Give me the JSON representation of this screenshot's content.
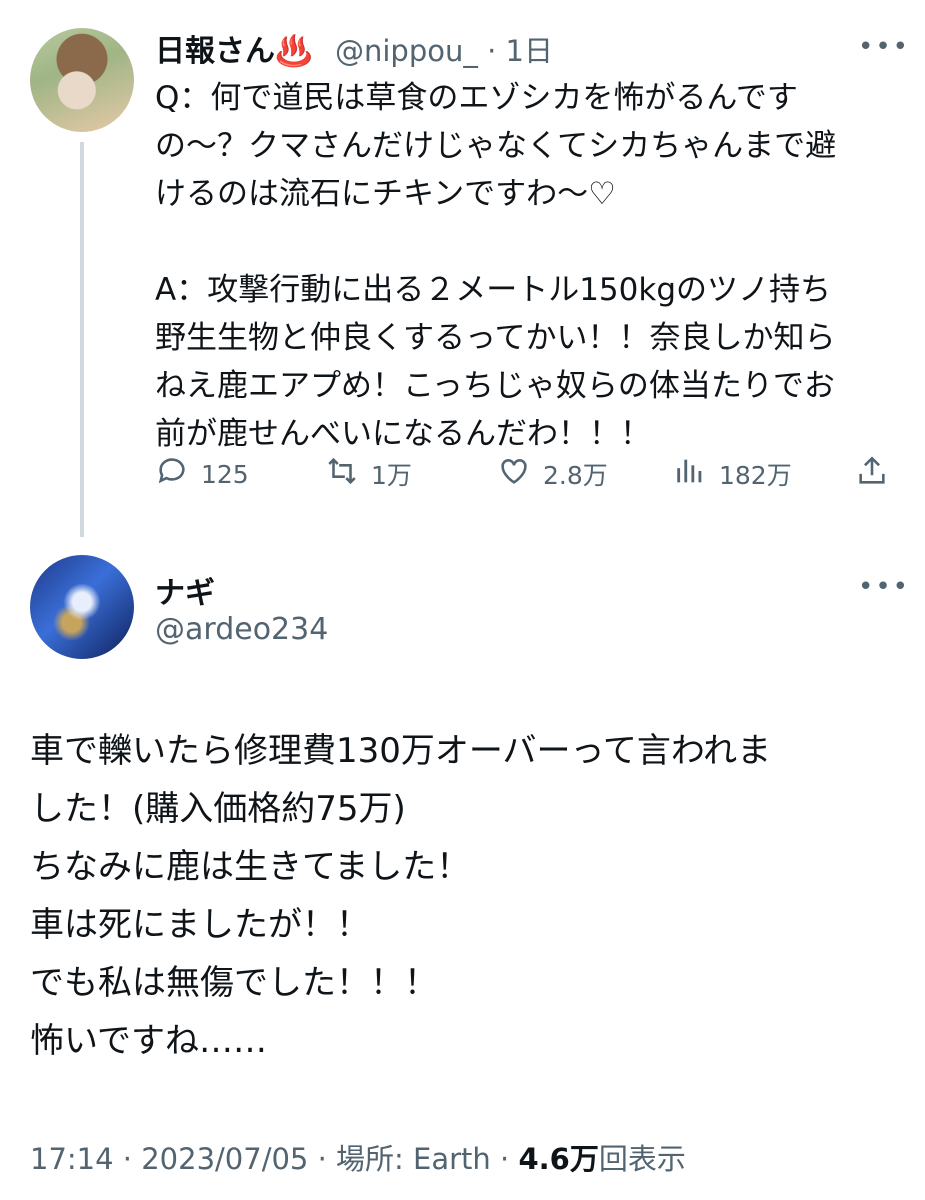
{
  "parent_tweet": {
    "display_name": "日報さん♨️",
    "handle": "@nippou_",
    "time": "· 1日",
    "more": "•••",
    "body": "Q：何で道民は草食のエゾシカを怖がるんです\nの〜？クマさんだけじゃなくてシカちゃんまで避\nけるのは流石にチキンですわ〜♡\n\nA：攻撃行動に出る２メートル150kgのツノ持ち\n野生生物と仲良くするってかい！！奈良しか知ら\nねえ鹿エアプめ！こっちじゃ奴らの体当たりでお\n前が鹿せんべいになるんだわ！！！",
    "stats": {
      "replies": "125",
      "retweets": "1万",
      "likes": "2.8万",
      "views": "182万"
    }
  },
  "reply_tweet": {
    "display_name": "ナギ",
    "handle": "@ardeo234",
    "more": "•••",
    "body": "車で轢いたら修理費130万オーバーって言われま\nした！(購入価格約75万)\nちなみに鹿は生きてました！\n車は死にましたが！！\nでも私は無傷でした！！！\n怖いですね……",
    "meta": {
      "time": "17:14 · 2023/07/05",
      "location": " · 場所: Earth · ",
      "views_count": "4.6万",
      "views_label": "回表示"
    }
  },
  "icons": [
    "reply-icon",
    "retweet-icon",
    "like-icon",
    "views-icon",
    "share-icon",
    "more-icon"
  ],
  "colors": {
    "text": "#0f1419",
    "secondary": "#536471",
    "thread_line": "#cfd9de"
  }
}
